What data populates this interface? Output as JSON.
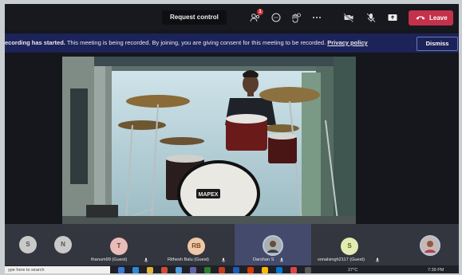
{
  "toolbar": {
    "request_control_label": "Request control",
    "participants_badge": "1",
    "leave_label": "Leave",
    "leave_color": "#c4314b"
  },
  "notice": {
    "started": "ecording has started.",
    "message": "This meeting is being recorded. By joining, you are giving consent for this meeting to be recorded.",
    "policy_link": "Privacy policy",
    "dismiss_label": "Dismiss"
  },
  "participants": [
    {
      "initials": "S",
      "name": "",
      "icon": "avatar"
    },
    {
      "initials": "N",
      "name": "",
      "icon": "avatar"
    },
    {
      "initials": "T",
      "name": "thanum99 (Guest)",
      "icon": "avatar"
    },
    {
      "initials": "RB",
      "name": "Rithesh Balu (Guest)",
      "icon": "avatar"
    },
    {
      "initials": "",
      "name": "Darshan S",
      "icon": "photo-avatar"
    },
    {
      "initials": "S",
      "name": "sonalsingh2117 (Guest)",
      "icon": "avatar"
    },
    {
      "initials": "",
      "name": "",
      "icon": "photo-avatar"
    }
  ],
  "video": {
    "drum_logo": "MAPEX"
  },
  "taskbar": {
    "search_placeholder": "ype here to search",
    "temperature": "27°C",
    "time": "7:39 PM"
  }
}
